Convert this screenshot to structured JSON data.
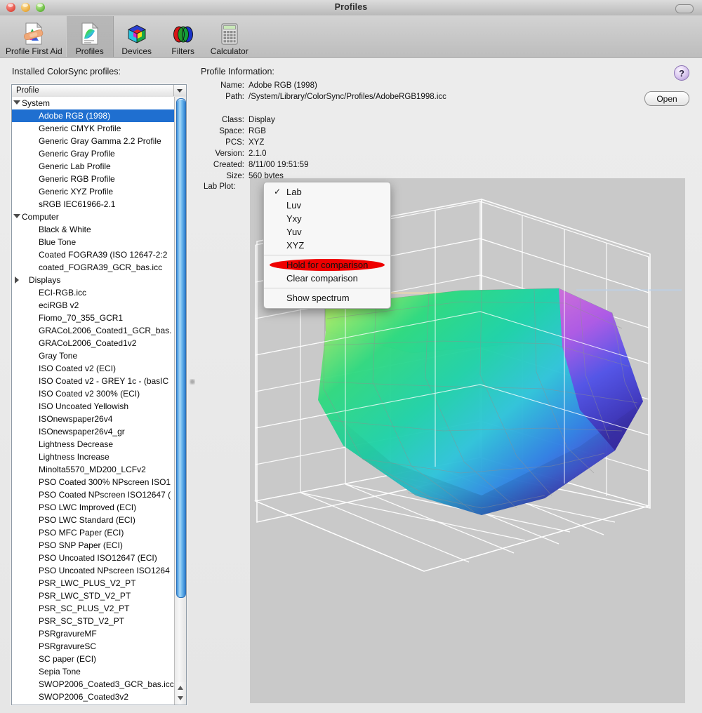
{
  "window": {
    "title": "Profiles"
  },
  "toolbar": {
    "items": [
      {
        "label": "Profile First Aid",
        "icon": "profile-first-aid-icon",
        "selected": false
      },
      {
        "label": "Profiles",
        "icon": "profiles-icon",
        "selected": true
      },
      {
        "label": "Devices",
        "icon": "devices-cube-icon",
        "selected": false
      },
      {
        "label": "Filters",
        "icon": "filters-venn-icon",
        "selected": false
      },
      {
        "label": "Calculator",
        "icon": "calculator-icon",
        "selected": false
      }
    ]
  },
  "left_pane": {
    "heading": "Installed ColorSync profiles:",
    "column_header": "Profile",
    "sort_icon": "chevron-down-icon",
    "rows": [
      {
        "label": "System",
        "type": "group",
        "expanded": true
      },
      {
        "label": "Adobe RGB (1998)",
        "type": "leaf",
        "selected": true
      },
      {
        "label": "Generic CMYK Profile",
        "type": "leaf"
      },
      {
        "label": "Generic Gray Gamma 2.2 Profile",
        "type": "leaf"
      },
      {
        "label": "Generic Gray Profile",
        "type": "leaf"
      },
      {
        "label": "Generic Lab Profile",
        "type": "leaf"
      },
      {
        "label": "Generic RGB Profile",
        "type": "leaf"
      },
      {
        "label": "Generic XYZ Profile",
        "type": "leaf"
      },
      {
        "label": "sRGB IEC61966-2.1",
        "type": "leaf"
      },
      {
        "label": "Computer",
        "type": "group",
        "expanded": true
      },
      {
        "label": "Black & White",
        "type": "leaf"
      },
      {
        "label": "Blue Tone",
        "type": "leaf"
      },
      {
        "label": "Coated FOGRA39 (ISO 12647-2:2",
        "type": "leaf"
      },
      {
        "label": "coated_FOGRA39_GCR_bas.icc",
        "type": "leaf"
      },
      {
        "label": "Displays",
        "type": "subgroup",
        "expanded": false
      },
      {
        "label": "ECI-RGB.icc",
        "type": "leaf"
      },
      {
        "label": "eciRGB v2",
        "type": "leaf"
      },
      {
        "label": "Fiomo_70_355_GCR1",
        "type": "leaf"
      },
      {
        "label": "GRACoL2006_Coated1_GCR_bas.",
        "type": "leaf"
      },
      {
        "label": "GRACoL2006_Coated1v2",
        "type": "leaf"
      },
      {
        "label": "Gray Tone",
        "type": "leaf"
      },
      {
        "label": "ISO Coated v2 (ECI)",
        "type": "leaf"
      },
      {
        "label": "ISO Coated v2 - GREY 1c - (basIC",
        "type": "leaf"
      },
      {
        "label": "ISO Coated v2 300% (ECI)",
        "type": "leaf"
      },
      {
        "label": "ISO Uncoated Yellowish",
        "type": "leaf"
      },
      {
        "label": "ISOnewspaper26v4",
        "type": "leaf"
      },
      {
        "label": "ISOnewspaper26v4_gr",
        "type": "leaf"
      },
      {
        "label": "Lightness Decrease",
        "type": "leaf"
      },
      {
        "label": "Lightness Increase",
        "type": "leaf"
      },
      {
        "label": "Minolta5570_MD200_LCFv2",
        "type": "leaf"
      },
      {
        "label": "PSO Coated 300% NPscreen ISO1",
        "type": "leaf"
      },
      {
        "label": "PSO Coated NPscreen ISO12647 (",
        "type": "leaf"
      },
      {
        "label": "PSO LWC Improved (ECI)",
        "type": "leaf"
      },
      {
        "label": "PSO LWC Standard (ECI)",
        "type": "leaf"
      },
      {
        "label": "PSO MFC Paper (ECI)",
        "type": "leaf"
      },
      {
        "label": "PSO SNP Paper (ECI)",
        "type": "leaf"
      },
      {
        "label": "PSO Uncoated ISO12647 (ECI)",
        "type": "leaf"
      },
      {
        "label": "PSO Uncoated NPscreen ISO1264",
        "type": "leaf"
      },
      {
        "label": "PSR_LWC_PLUS_V2_PT",
        "type": "leaf"
      },
      {
        "label": "PSR_LWC_STD_V2_PT",
        "type": "leaf"
      },
      {
        "label": "PSR_SC_PLUS_V2_PT",
        "type": "leaf"
      },
      {
        "label": "PSR_SC_STD_V2_PT",
        "type": "leaf"
      },
      {
        "label": "PSRgravureMF",
        "type": "leaf"
      },
      {
        "label": "PSRgravureSC",
        "type": "leaf"
      },
      {
        "label": "SC paper (ECI)",
        "type": "leaf"
      },
      {
        "label": "Sepia Tone",
        "type": "leaf"
      },
      {
        "label": "SWOP2006_Coated3_GCR_bas.icc",
        "type": "leaf"
      },
      {
        "label": "SWOP2006_Coated3v2",
        "type": "leaf"
      }
    ]
  },
  "right_pane": {
    "heading": "Profile Information:",
    "help_label": "?",
    "open_label": "Open",
    "fields": [
      {
        "key": "Name:",
        "value": "Adobe RGB (1998)"
      },
      {
        "key": "Path:",
        "value": "/System/Library/ColorSync/Profiles/AdobeRGB1998.icc"
      },
      {
        "key": "Class:",
        "value": "Display"
      },
      {
        "key": "Space:",
        "value": "RGB"
      },
      {
        "key": "PCS:",
        "value": "XYZ"
      },
      {
        "key": "Version:",
        "value": "2.1.0"
      },
      {
        "key": "Created:",
        "value": "8/11/00 19:51:59"
      },
      {
        "key": "Size:",
        "value": "560 bytes"
      }
    ],
    "lab_plot_label": "Lab Plot:",
    "plot_popup_icon": "triangle-down-icon"
  },
  "menu": {
    "items": [
      {
        "label": "Lab",
        "checked": true
      },
      {
        "label": "Luv",
        "checked": false
      },
      {
        "label": "Yxy",
        "checked": false
      },
      {
        "label": "Yuv",
        "checked": false
      },
      {
        "label": "XYZ",
        "checked": false
      },
      {
        "separator": true
      },
      {
        "label": "Hold for comparison",
        "checked": false,
        "highlighted": true
      },
      {
        "label": "Clear comparison",
        "checked": false
      },
      {
        "separator": true
      },
      {
        "label": "Show spectrum",
        "checked": false
      }
    ],
    "check_glyph": "✓",
    "highlight_color": "#ee0000"
  },
  "colors": {
    "selection_blue": "#1f6fd0",
    "plot_background": "#c9c9c9",
    "grid_white": "#ffffff",
    "annotation_red": "#ee0000"
  }
}
